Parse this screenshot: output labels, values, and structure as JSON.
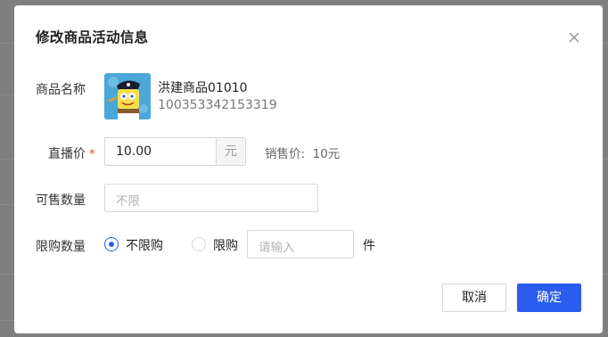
{
  "dialog": {
    "title": "修改商品活动信息",
    "close_icon": "close-icon"
  },
  "product": {
    "label": "商品名称",
    "name": "洪建商品01010",
    "id": "100353342153319",
    "image": "spongebob-pirate-thumbnail"
  },
  "live_price": {
    "label": "直播价",
    "required_mark": "*",
    "value": "10.00",
    "unit": "元",
    "sale_price_text": "销售价:  10元"
  },
  "stock": {
    "label": "可售数量",
    "placeholder": "不限"
  },
  "purchase_limit": {
    "label": "限购数量",
    "options": [
      {
        "label": "不限购",
        "selected": true
      },
      {
        "label": "限购",
        "selected": false
      }
    ],
    "input_placeholder": "请输入",
    "unit": "件"
  },
  "footer": {
    "cancel_label": "取消",
    "ok_label": "确定"
  },
  "colors": {
    "primary": "#2b5cf0",
    "required": "#e53935",
    "overlay": "#7f7f7f"
  }
}
